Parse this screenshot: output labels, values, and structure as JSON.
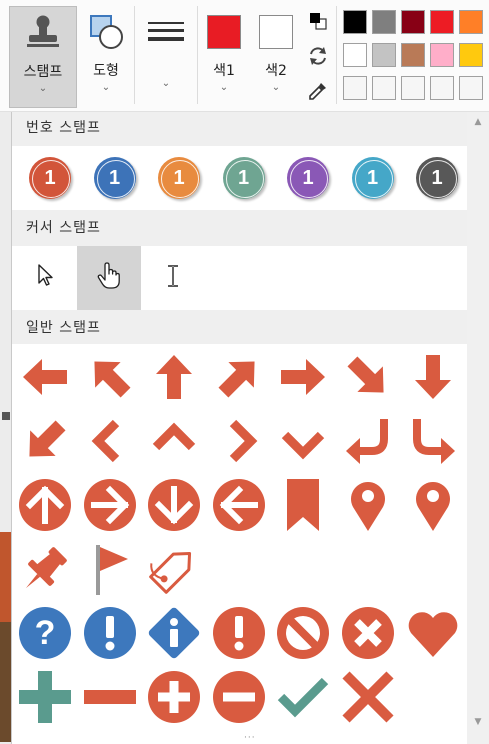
{
  "ribbon": {
    "stamp_label": "스탬프",
    "shape_label": "도형",
    "color1_label": "색1",
    "color2_label": "색2",
    "color1": "#e81c24",
    "color2": "#ffffff",
    "icons": {
      "stamp": "stamp-icon",
      "shape": "shapes-icon",
      "line": "line-thickness-icon",
      "swap": "swap-colors-icon",
      "refresh": "reset-colors-icon",
      "eyedropper": "eyedropper-icon"
    },
    "palette": [
      "#000000",
      "#7f7f7f",
      "#880015",
      "#ed1c24",
      "#ff7f27",
      "#ffffff",
      "#c3c3c3",
      "#b97a57",
      "#ffaec9",
      "#ffc90e",
      "",
      "",
      "",
      "",
      ""
    ]
  },
  "panel": {
    "number_section": "번호 스탬프",
    "cursor_section": "커서 스탬프",
    "general_section": "일반 스탬프",
    "number_stamps": [
      {
        "label": "1",
        "color": "#d2553a"
      },
      {
        "label": "1",
        "color": "#3d73b8"
      },
      {
        "label": "1",
        "color": "#e88b3f"
      },
      {
        "label": "1",
        "color": "#6fa592"
      },
      {
        "label": "1",
        "color": "#8a58b6"
      },
      {
        "label": "1",
        "color": "#45a7c8"
      },
      {
        "label": "1",
        "color": "#585858"
      }
    ],
    "cursor_stamps": [
      "arrow-cursor-icon",
      "hand-cursor-icon",
      "text-cursor-icon"
    ],
    "stamp_color": "#d95b40",
    "blue_color": "#3d78bd",
    "green_color": "#5a9b8e",
    "gray_color": "#9a9a9a"
  }
}
